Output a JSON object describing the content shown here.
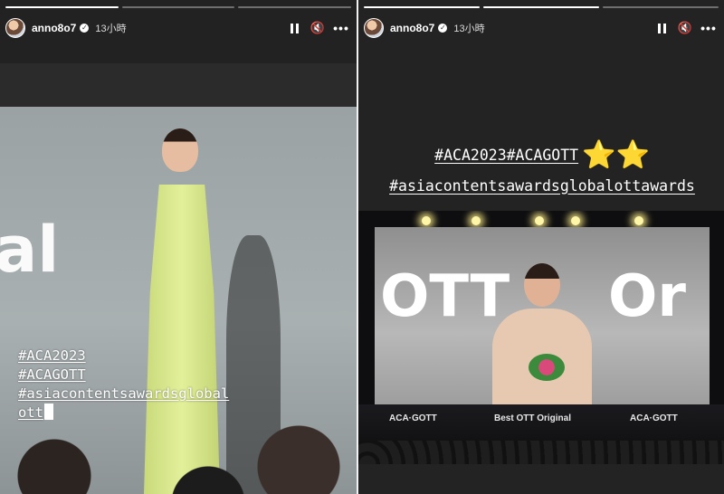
{
  "stories": [
    {
      "username": "anno8o7",
      "verified_mark": "✓",
      "time": "13小時",
      "progress": [
        1.0,
        0.0,
        0.0
      ],
      "hashtags": [
        "#ACA2023",
        "#ACAGOTT",
        "#asiacontentsawardsglobal",
        "ott"
      ],
      "photo_text": "al"
    },
    {
      "username": "anno8o7",
      "verified_mark": "✓",
      "time": "13小時",
      "progress": [
        1.0,
        1.0,
        0.0
      ],
      "hashtags": [
        "#ACA2023#ACAGOTT",
        "#asiacontentsawardsglobalottawards"
      ],
      "stars": "⭐⭐",
      "photo_text_left": "OTT",
      "photo_text_right": "Or",
      "stage_banner_left": "ACA·GOTT",
      "stage_banner_mid": "Best OTT Original",
      "stage_banner_right": "ACA·GOTT"
    }
  ],
  "controls": {
    "pause_icon": "pause-icon",
    "mute_icon": "mute-icon",
    "more_icon": "more-icon",
    "more_label": "•••",
    "mute_label": "🔇"
  },
  "colors": {
    "star": "#f7c52e",
    "dress": "#e3f09a"
  }
}
